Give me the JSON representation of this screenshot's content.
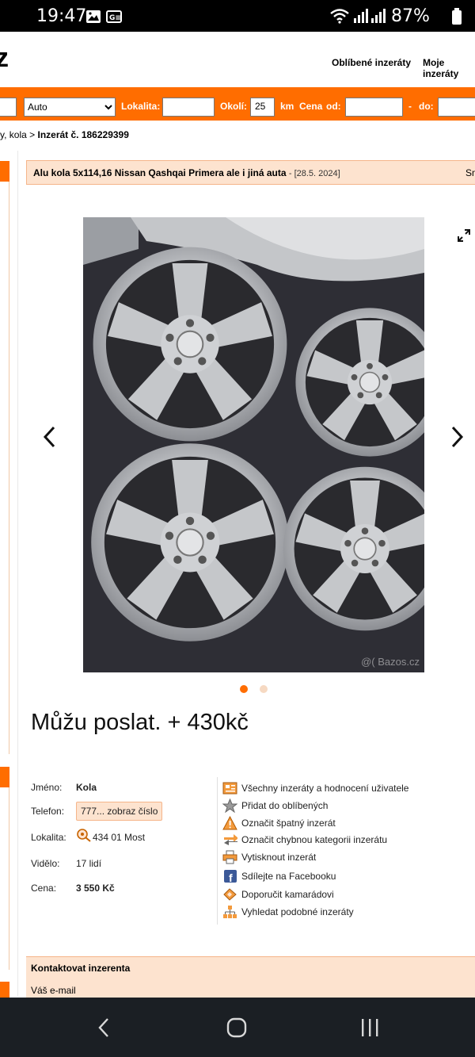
{
  "status": {
    "time": "19:47",
    "battery": "87%"
  },
  "header": {
    "logo": "z",
    "nav": [
      "Oblíbené inzeráty",
      "Moje inzeráty"
    ]
  },
  "search": {
    "category": "Auto",
    "location_label": "Lokalita:",
    "location_value": "",
    "radius_label": "Okolí:",
    "radius_value": "25",
    "radius_unit": "km",
    "price_label": "Cena",
    "price_from_label": "od:",
    "price_from_value": "",
    "price_sep": "-",
    "price_to_label": "do:",
    "price_to_value": ""
  },
  "breadcrumb": {
    "prefix": "y, kola >",
    "current": "Inzerát č. 186229399"
  },
  "ad": {
    "title": "Alu kola 5x114,16 Nissan Qashqai Primera ale i jiná auta",
    "date": "- [28.5. 2024]",
    "more": "Sm",
    "watermark": "@( Bazos.cz",
    "headline": "Můžu poslat. + 430kč",
    "gallery": {
      "current_slide": 1,
      "total_slides": 2
    }
  },
  "details": {
    "name_label": "Jméno:",
    "name_value": "Kola",
    "phone_label": "Telefon:",
    "phone_value": "777... zobraz číslo",
    "location_label": "Lokalita:",
    "location_value": "434 01 Most",
    "views_label": "Vidělo:",
    "views_value": "17 lidí",
    "price_label": "Cena:",
    "price_value": "3 550 Kč"
  },
  "actions": [
    {
      "label": "Všechny inzeráty a hodnocení uživatele",
      "icon": "user-list-icon"
    },
    {
      "label": "Přidat do oblíbených",
      "icon": "star-icon"
    },
    {
      "label": "Označit špatný inzerát",
      "icon": "warning-icon"
    },
    {
      "label": "Označit chybnou kategorii inzerátu",
      "icon": "swap-arrows-icon"
    },
    {
      "label": "Vytisknout inzerát",
      "icon": "printer-icon"
    },
    {
      "label": "Sdílejte na Facebooku",
      "icon": "facebook-icon"
    },
    {
      "label": "Doporučit kamarádovi",
      "icon": "recommend-icon"
    },
    {
      "label": "Vyhledat podobné inzeráty",
      "icon": "similar-icon"
    }
  ],
  "contact": {
    "title": "Kontaktovat inzerenta",
    "email_label": "Váš e-mail"
  },
  "colors": {
    "accent": "#ff6d00",
    "highlight": "#fde3cf"
  }
}
